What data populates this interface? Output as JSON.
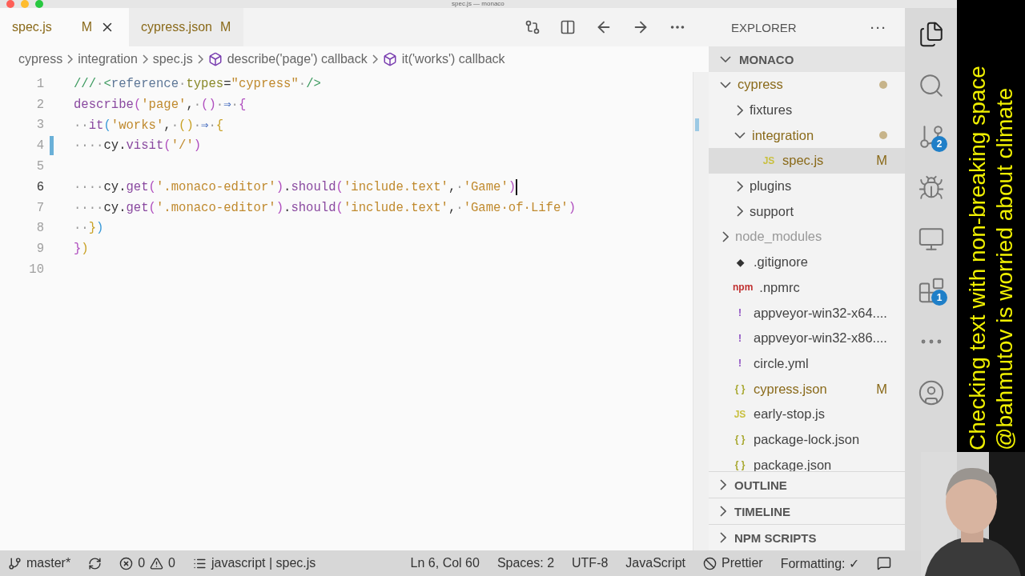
{
  "window": {
    "title": "spec.js — monaco"
  },
  "tabs": [
    {
      "label": "spec.js",
      "status": "M",
      "selected": true
    },
    {
      "label": "cypress.json",
      "status": "M",
      "selected": false
    }
  ],
  "breadcrumbs": [
    {
      "kind": "folder",
      "label": "cypress"
    },
    {
      "kind": "folder",
      "label": "integration"
    },
    {
      "kind": "file",
      "label": "spec.js"
    },
    {
      "kind": "symbol",
      "label": "describe('page') callback"
    },
    {
      "kind": "symbol",
      "label": "it('works') callback"
    }
  ],
  "code": [
    {
      "number": "1",
      "modified": false,
      "current": false,
      "tokens": [
        {
          "t": "///",
          "kind": "comment"
        },
        {
          "t": "·",
          "kind": "ws"
        },
        {
          "t": "<",
          "kind": "comment"
        },
        {
          "t": "reference",
          "kind": "tag"
        },
        {
          "t": "·",
          "kind": "ws"
        },
        {
          "t": "types",
          "kind": "attr"
        },
        {
          "t": "=",
          "kind": "plain"
        },
        {
          "t": "\"cypress\"",
          "kind": "string"
        },
        {
          "t": "·",
          "kind": "ws"
        },
        {
          "t": "/>",
          "kind": "comment"
        }
      ]
    },
    {
      "number": "2",
      "modified": false,
      "current": false,
      "tokens": [
        {
          "t": "describe",
          "kind": "fn"
        },
        {
          "t": "(",
          "kind": "b2"
        },
        {
          "t": "'page'",
          "kind": "string"
        },
        {
          "t": ",",
          "kind": "plain"
        },
        {
          "t": "·",
          "kind": "ws"
        },
        {
          "t": "()",
          "kind": "b2"
        },
        {
          "t": "·",
          "kind": "ws"
        },
        {
          "t": "⇒",
          "kind": "arrow"
        },
        {
          "t": "·",
          "kind": "ws"
        },
        {
          "t": "{",
          "kind": "b2"
        }
      ]
    },
    {
      "number": "3",
      "modified": false,
      "current": false,
      "tokens": [
        {
          "t": "··",
          "kind": "ws"
        },
        {
          "t": "it",
          "kind": "fn"
        },
        {
          "t": "(",
          "kind": "b3"
        },
        {
          "t": "'works'",
          "kind": "string"
        },
        {
          "t": ",",
          "kind": "plain"
        },
        {
          "t": "·",
          "kind": "ws"
        },
        {
          "t": "()",
          "kind": "b1"
        },
        {
          "t": "·",
          "kind": "ws"
        },
        {
          "t": "⇒",
          "kind": "arrow"
        },
        {
          "t": "·",
          "kind": "ws"
        },
        {
          "t": "{",
          "kind": "b1"
        }
      ]
    },
    {
      "number": "4",
      "modified": true,
      "current": false,
      "tokens": [
        {
          "t": "····",
          "kind": "ws"
        },
        {
          "t": "cy.",
          "kind": "plain"
        },
        {
          "t": "visit",
          "kind": "fn"
        },
        {
          "t": "(",
          "kind": "b2"
        },
        {
          "t": "'/'",
          "kind": "string"
        },
        {
          "t": ")",
          "kind": "b2"
        }
      ]
    },
    {
      "number": "5",
      "modified": false,
      "current": false
    },
    {
      "number": "6",
      "modified": false,
      "current": true,
      "tokens": [
        {
          "t": "····",
          "kind": "ws"
        },
        {
          "t": "cy.",
          "kind": "plain"
        },
        {
          "t": "get",
          "kind": "fn"
        },
        {
          "t": "(",
          "kind": "b2"
        },
        {
          "t": "'.monaco-editor'",
          "kind": "string"
        },
        {
          "t": ")",
          "kind": "b2"
        },
        {
          "t": ".",
          "kind": "plain"
        },
        {
          "t": "should",
          "kind": "fn"
        },
        {
          "t": "(",
          "kind": "b2"
        },
        {
          "t": "'include.text'",
          "kind": "string"
        },
        {
          "t": ",",
          "kind": "plain"
        },
        {
          "t": "·",
          "kind": "ws"
        },
        {
          "t": "'Game'",
          "kind": "string"
        },
        {
          "t": ")",
          "kind": "b2"
        }
      ]
    },
    {
      "number": "7",
      "modified": false,
      "current": false,
      "tokens": [
        {
          "t": "····",
          "kind": "ws"
        },
        {
          "t": "cy.",
          "kind": "plain"
        },
        {
          "t": "get",
          "kind": "fn"
        },
        {
          "t": "(",
          "kind": "b2"
        },
        {
          "t": "'.monaco-editor'",
          "kind": "string"
        },
        {
          "t": ")",
          "kind": "b2"
        },
        {
          "t": ".",
          "kind": "plain"
        },
        {
          "t": "should",
          "kind": "fn"
        },
        {
          "t": "(",
          "kind": "b2"
        },
        {
          "t": "'include.text'",
          "kind": "string"
        },
        {
          "t": ",",
          "kind": "plain"
        },
        {
          "t": "·",
          "kind": "ws"
        },
        {
          "t": "'Game·of·Life'",
          "kind": "string"
        },
        {
          "t": ")",
          "kind": "b2"
        }
      ]
    },
    {
      "number": "8",
      "modified": false,
      "current": false,
      "tokens": [
        {
          "t": "··",
          "kind": "ws"
        },
        {
          "t": "}",
          "kind": "b1"
        },
        {
          "t": ")",
          "kind": "b3"
        }
      ]
    },
    {
      "number": "9",
      "modified": false,
      "current": false,
      "tokens": [
        {
          "t": "}",
          "kind": "b2"
        },
        {
          "t": ")",
          "kind": "b1"
        }
      ]
    },
    {
      "number": "10",
      "modified": false,
      "current": false
    }
  ],
  "sidebar": {
    "title": "EXPLORER",
    "more": "···",
    "root": {
      "label": "MONACO",
      "expanded": true
    },
    "tree": [
      {
        "kind": "folder",
        "label": "cypress",
        "expanded": true,
        "modified": true,
        "dot": true,
        "selected": false,
        "children": [
          {
            "kind": "folder",
            "label": "fixtures",
            "expanded": false,
            "modified": false,
            "selected": false
          },
          {
            "kind": "folder",
            "label": "integration",
            "expanded": true,
            "modified": true,
            "dot": true,
            "selected": false,
            "children": [
              {
                "kind": "js",
                "icon": "JS",
                "label": "spec.js",
                "modified": true,
                "status": "M",
                "selected": true
              }
            ]
          },
          {
            "kind": "folder",
            "label": "plugins",
            "expanded": false,
            "modified": false,
            "selected": false
          },
          {
            "kind": "folder",
            "label": "support",
            "expanded": false,
            "modified": false,
            "selected": false
          }
        ]
      },
      {
        "kind": "folder",
        "label": "node_modules",
        "expanded": false,
        "modified": false,
        "ignored": true,
        "selected": false
      },
      {
        "kind": "git",
        "icon": "◆",
        "label": ".gitignore",
        "modified": false,
        "selected": false
      },
      {
        "kind": "npm",
        "icon": "npm",
        "label": ".npmrc",
        "modified": false,
        "selected": false
      },
      {
        "kind": "yaml",
        "icon": "!",
        "label": "appveyor-win32-x64....",
        "modified": false,
        "selected": false
      },
      {
        "kind": "yaml",
        "icon": "!",
        "label": "appveyor-win32-x86....",
        "modified": false,
        "selected": false
      },
      {
        "kind": "yaml",
        "icon": "!",
        "label": "circle.yml",
        "modified": false,
        "selected": false
      },
      {
        "kind": "json",
        "icon": "{ }",
        "label": "cypress.json",
        "modified": true,
        "status": "M",
        "selected": false
      },
      {
        "kind": "js",
        "icon": "JS",
        "label": "early-stop.js",
        "modified": false,
        "selected": false
      },
      {
        "kind": "json",
        "icon": "{ }",
        "label": "package-lock.json",
        "modified": false,
        "selected": false
      },
      {
        "kind": "json",
        "icon": "{ }",
        "label": "package.json",
        "modified": false,
        "selected": false
      }
    ],
    "sections": [
      {
        "label": "OUTLINE",
        "expanded": false
      },
      {
        "label": "TIMELINE",
        "expanded": false
      },
      {
        "label": "NPM SCRIPTS",
        "expanded": false
      }
    ]
  },
  "activity_bar": [
    {
      "kind": "explorer",
      "selected": true
    },
    {
      "kind": "search",
      "selected": false
    },
    {
      "kind": "source-control",
      "badge": "2",
      "selected": false
    },
    {
      "kind": "run",
      "selected": false
    },
    {
      "kind": "remote",
      "selected": false
    },
    {
      "kind": "extensions",
      "badge": "1",
      "selected": false
    },
    {
      "kind": "more",
      "selected": false
    },
    {
      "kind": "account",
      "selected": false
    }
  ],
  "status_bar": {
    "left": [
      {
        "kind": "branch",
        "text": "master*"
      },
      {
        "kind": "sync"
      },
      {
        "kind": "problems",
        "errors": "0",
        "warnings": "0"
      },
      {
        "kind": "outline",
        "text": "javascript | spec.js"
      }
    ],
    "right": [
      {
        "kind": "text",
        "text": "Ln 6, Col 60"
      },
      {
        "kind": "text",
        "text": "Spaces: 2"
      },
      {
        "kind": "text",
        "text": "UTF-8"
      },
      {
        "kind": "text",
        "text": "JavaScript"
      },
      {
        "kind": "prettier",
        "text": "Prettier"
      },
      {
        "kind": "text",
        "text": "Formatting: ✓"
      },
      {
        "kind": "feedback"
      }
    ]
  },
  "caption": {
    "lines": [
      "Checking text with non-breaking space",
      "@bahmutov is worried about climate"
    ]
  }
}
